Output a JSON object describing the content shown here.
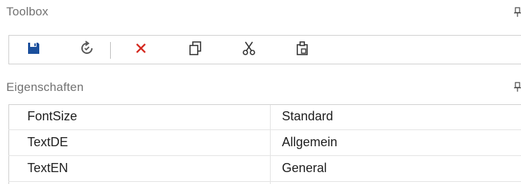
{
  "toolbox": {
    "title": "Toolbox",
    "tools": [
      {
        "name": "save-icon",
        "color": "#1b4f9c"
      },
      {
        "name": "refresh-icon",
        "color": "#555555"
      },
      {
        "name": "delete-icon",
        "color": "#d42a20"
      },
      {
        "name": "copy-icon",
        "color": "#333333"
      },
      {
        "name": "cut-icon",
        "color": "#333333"
      },
      {
        "name": "paste-icon",
        "color": "#333333"
      }
    ]
  },
  "properties": {
    "title": "Eigenschaften",
    "rows": [
      {
        "name": "FontSize",
        "value": "Standard"
      },
      {
        "name": "TextDE",
        "value": "Allgemein"
      },
      {
        "name": "TextEN",
        "value": "General"
      }
    ]
  }
}
